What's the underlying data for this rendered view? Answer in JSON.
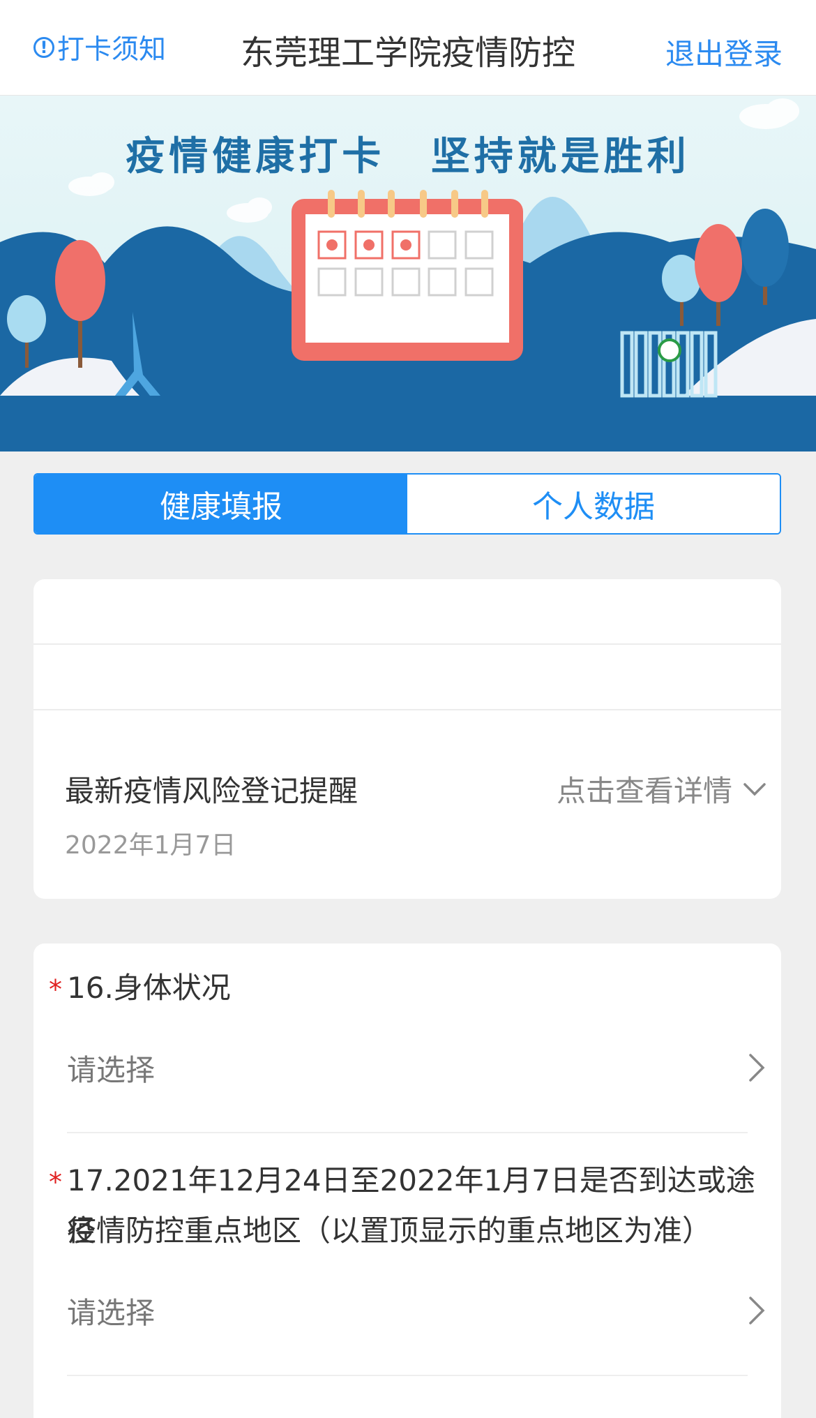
{
  "header": {
    "notice_icon": "info-circle-icon",
    "notice_glyph": "!",
    "notice_label": "打卡须知",
    "title": "东莞理工学院疫情防控",
    "logout_label": "退出登录"
  },
  "banner": {
    "slogan": "疫情健康打卡  坚持就是胜利"
  },
  "tabs": [
    {
      "label": "健康填报",
      "active": true
    },
    {
      "label": "个人数据",
      "active": false
    }
  ],
  "reminder": {
    "title": "最新疫情风险登记提醒",
    "date": "2022年1月7日",
    "detail_label": "点击查看详情",
    "detail_icon": "chevron-down-icon"
  },
  "questions": [
    {
      "required_mark": "*",
      "label": "16.身体状况",
      "placeholder": "请选择",
      "icon": "chevron-right-icon"
    },
    {
      "required_mark": "*",
      "label_line1": "17.2021年12月24日至2022年1月7日是否到达或途径",
      "label_line2": "疫情防控重点地区（以置顶显示的重点地区为准）",
      "placeholder": "请选择",
      "icon": "chevron-right-icon"
    }
  ],
  "colors": {
    "accent": "#1e8ef5",
    "link": "#2b8af0",
    "required": "#e02020",
    "banner_blue": "#1f6fa6"
  }
}
